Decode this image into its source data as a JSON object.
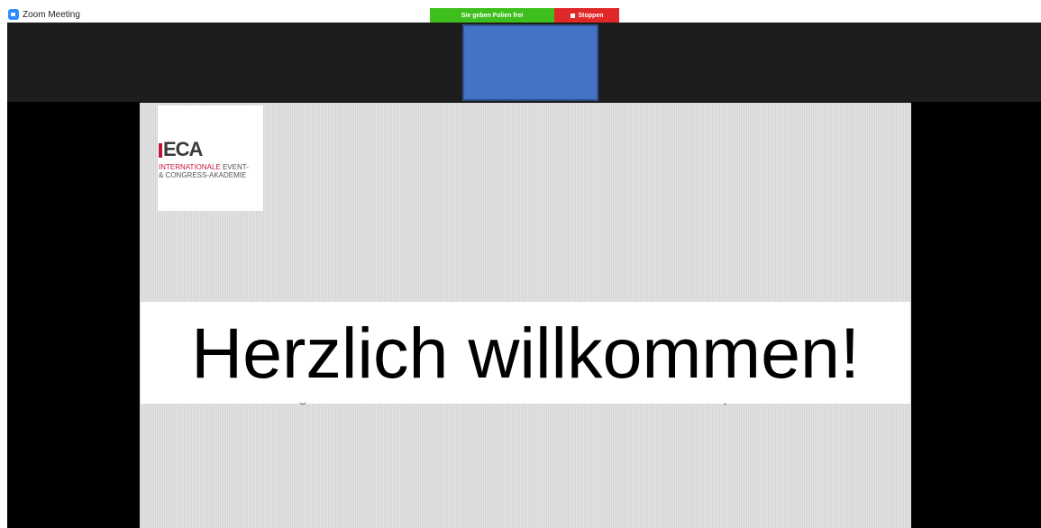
{
  "window": {
    "title": "Zoom Meeting",
    "icon": "zoom-app-icon"
  },
  "share_banner": {
    "status_text": "Sie geben Folien frei",
    "stop_label": "Stoppen",
    "status_color": "#3fbf1d",
    "stop_color": "#e02828"
  },
  "video_strip": {
    "tile_color": "#4472c4"
  },
  "slide": {
    "logo": {
      "letters": "ECA",
      "line1_accent": "INTERNATIONALE",
      "line1_rest": " EVENT-",
      "line2": "& CONGRESS-AKADEMIE",
      "accent_color": "#c3163f"
    },
    "headline": "Herzlich willkommen!"
  }
}
